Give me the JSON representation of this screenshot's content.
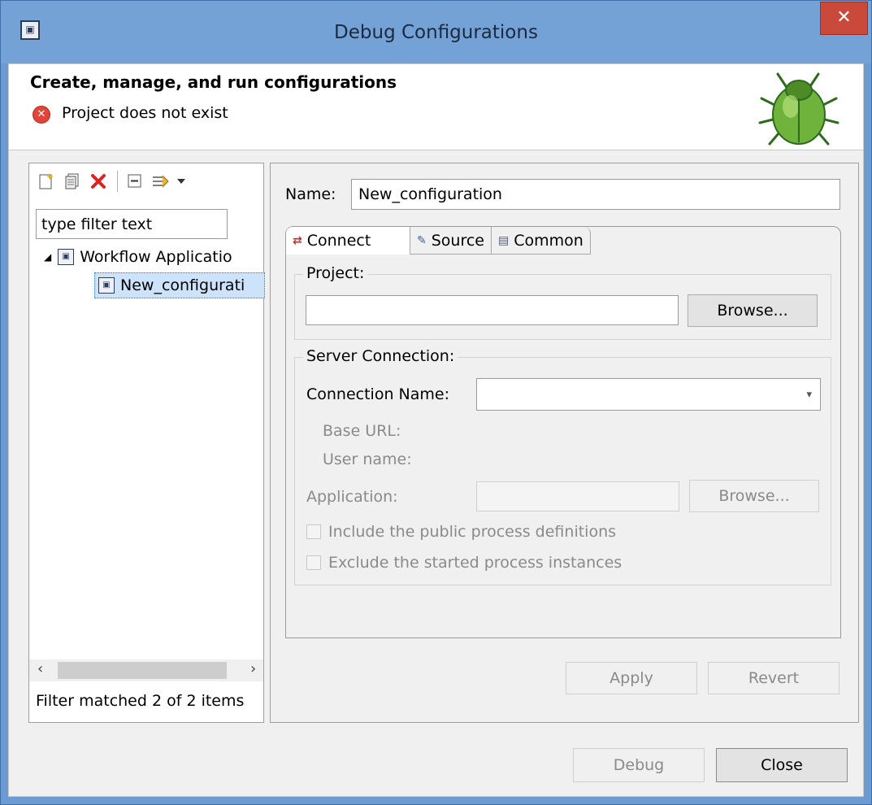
{
  "window": {
    "title": "Debug Configurations",
    "close_glyph": "✕"
  },
  "header": {
    "title": "Create, manage, and run configurations",
    "error": "Project does not exist"
  },
  "left": {
    "filter_value": "type filter text",
    "tree": [
      {
        "label": "Workflow Applicatio"
      },
      {
        "label": "New_configurati"
      }
    ],
    "status": "Filter matched 2 of 2 items"
  },
  "right": {
    "name_label": "Name:",
    "name_value": "New_configuration",
    "tabs": [
      {
        "label": "Connect"
      },
      {
        "label": "Source"
      },
      {
        "label": "Common"
      }
    ],
    "project": {
      "label": "Project:",
      "value": "",
      "browse": "Browse..."
    },
    "server": {
      "label": "Server Connection:",
      "connection_name_label": "Connection Name:",
      "connection_name_value": "",
      "base_url_label": "Base URL:",
      "user_name_label": "User name:",
      "application_label": "Application:",
      "application_value": "",
      "browse": "Browse...",
      "include_public": "Include the public process definitions",
      "exclude_started": "Exclude the started process instances"
    },
    "apply": "Apply",
    "revert": "Revert"
  },
  "footer": {
    "debug": "Debug",
    "close": "Close"
  },
  "icons": {
    "title": "debug-config-icon",
    "error": "error-icon",
    "bug": "bug-icon",
    "new": "new-config-icon",
    "duplicate": "duplicate-icon",
    "delete": "delete-icon",
    "collapse": "collapse-all-icon",
    "filter": "filter-icon",
    "connect": "connect-icon",
    "source": "source-icon",
    "common": "common-icon"
  }
}
